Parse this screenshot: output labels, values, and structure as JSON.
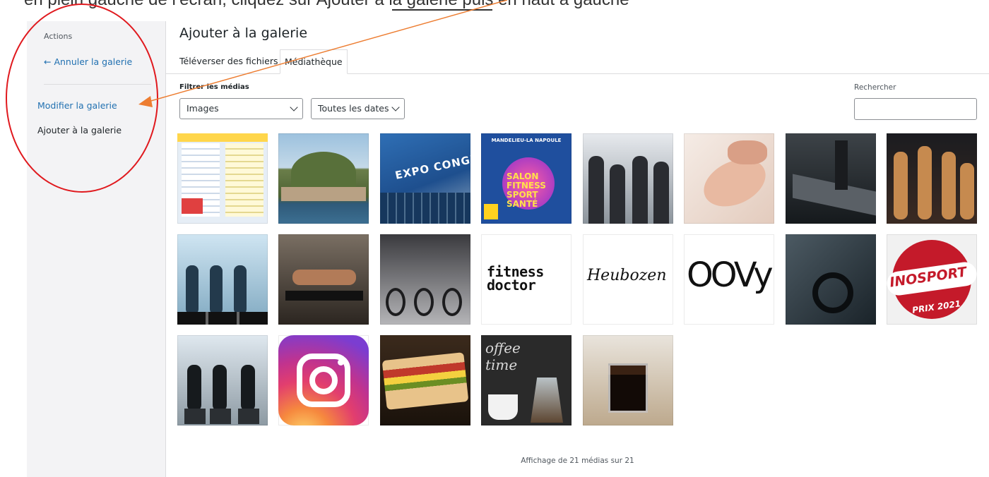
{
  "top_strip": {
    "cut_text": "en plein gauche de l’écran, cliquez sur Ajouter à la galerie puis en haut à gauche"
  },
  "sidebar": {
    "actions_title": "Actions",
    "cancel_link": "← Annuler la galerie",
    "edit_link": "Modifier la galerie",
    "add_link": "Ajouter à la galerie"
  },
  "main": {
    "title": "Ajouter à la galerie",
    "tabs": [
      {
        "label": "Téléverser des fichiers",
        "active": false
      },
      {
        "label": "Médiathèque",
        "active": true
      }
    ],
    "filter_label": "Filtrer les médias",
    "type_select": "Images",
    "date_select": "Toutes les dates",
    "search_label": "Rechercher",
    "search_value": ""
  },
  "media": [
    {
      "name": "programme-document"
    },
    {
      "name": "fort-on-hill"
    },
    {
      "name": "expo-congres"
    },
    {
      "name": "salon-fitness-poster",
      "text_top": "MANDELIEU-LA NAPOULE",
      "text_main": "SALON\nFITNESS\nSPORT\nSANTÉ"
    },
    {
      "name": "group-workout"
    },
    {
      "name": "face-massage"
    },
    {
      "name": "treadmill"
    },
    {
      "name": "boxing-class"
    },
    {
      "name": "step-class"
    },
    {
      "name": "pushup-step"
    },
    {
      "name": "bike-room"
    },
    {
      "name": "fitness-doctor-logo",
      "text": "fitness\ndoctor"
    },
    {
      "name": "heubozen-logo",
      "text": "Heubozen"
    },
    {
      "name": "oovy-logo",
      "text": "OOVY"
    },
    {
      "name": "spin-bike"
    },
    {
      "name": "inosport-badge",
      "text": "INOSPORT",
      "text2": "PRIX 2021"
    },
    {
      "name": "spin-class"
    },
    {
      "name": "instagram-logo"
    },
    {
      "name": "sandwich"
    },
    {
      "name": "coffee-time",
      "text": "offee\ntime"
    },
    {
      "name": "espresso"
    }
  ],
  "footer": {
    "count_text": "Affichage de 21 médias sur 21"
  },
  "colors": {
    "annotation_circle": "#e0191e",
    "annotation_arrow": "#ed7d31",
    "link": "#2271b1"
  }
}
